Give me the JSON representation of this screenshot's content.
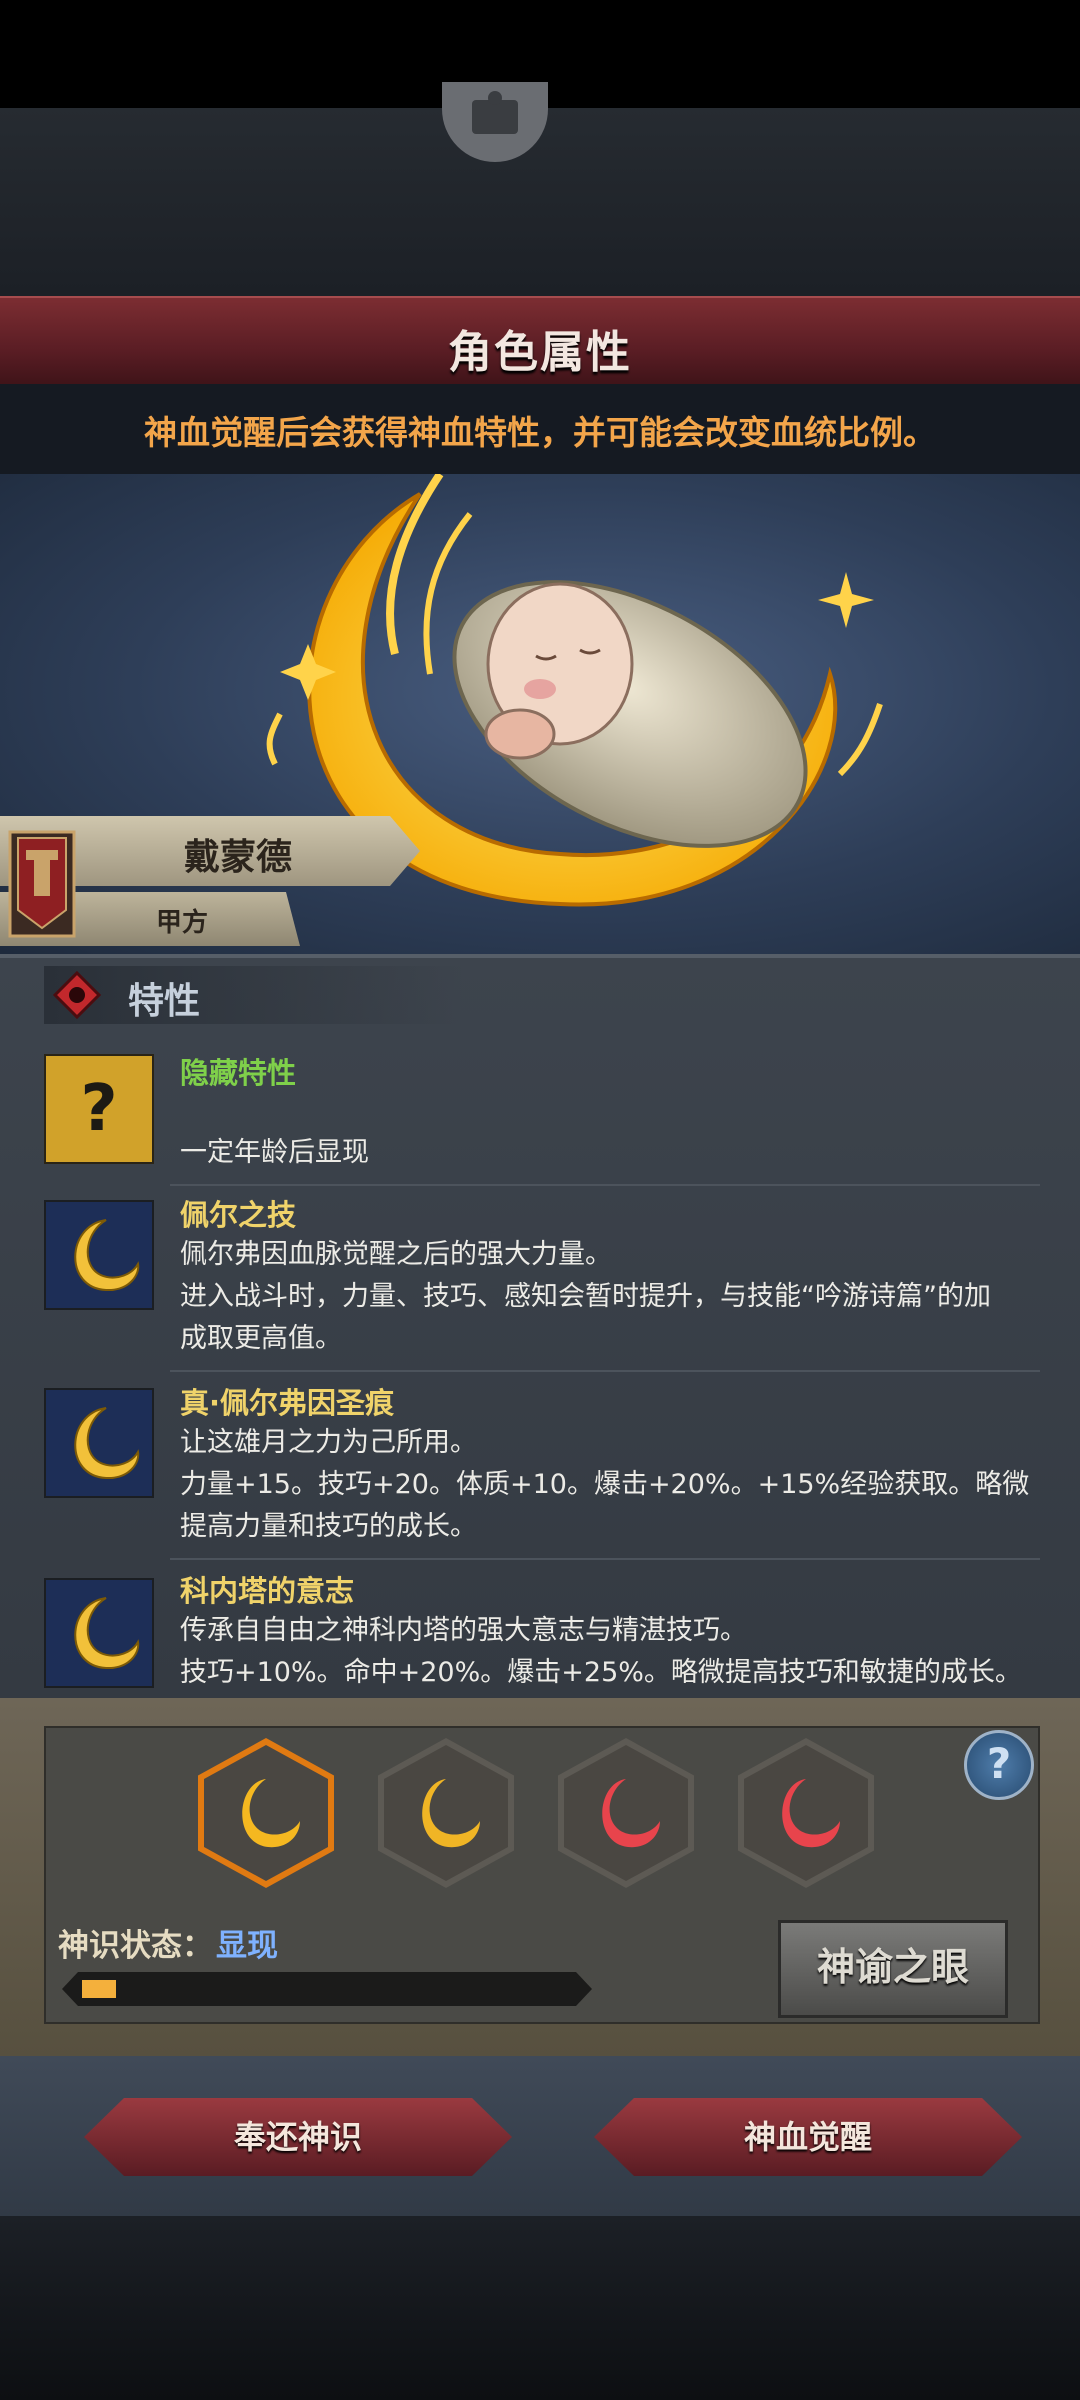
{
  "header": {
    "title": "角色属性",
    "notice": "神血觉醒后会获得神血特性，并可能会改变血统比例。"
  },
  "character": {
    "name": "戴蒙德",
    "faction": "甲方"
  },
  "traits": {
    "section_title": "特性",
    "items": [
      {
        "name": "隐藏特性",
        "lines": [
          "一定年龄后显现"
        ],
        "icon": "question-mark-icon",
        "name_color": "#7fd04a"
      },
      {
        "name": "佩尔之技",
        "lines": [
          "佩尔弗因血脉觉醒之后的强大力量。",
          "进入战斗时，力量、技巧、感知会暂时提升，与技能“吟游诗篇”的加",
          "成取更高值。"
        ],
        "icon": "crescent-moon-icon",
        "name_color": "#f0d36a"
      },
      {
        "name": "真·佩尔弗因圣痕",
        "lines": [
          "让这雄月之力为己所用。",
          "力量+15。技巧+20。体质+10。爆击+20%。+15%经验获取。略微",
          "提高力量和技巧的成长。"
        ],
        "icon": "crescent-moon-icon",
        "name_color": "#f0d36a"
      },
      {
        "name": "科内塔的意志",
        "lines": [
          "传承自自由之神科内塔的强大意志与精湛技巧。",
          "技巧+10%。命中+20%。爆击+25%。略微提高技巧和敏捷的成长。"
        ],
        "icon": "crescent-moon-icon",
        "name_color": "#f0d36a"
      }
    ]
  },
  "awakening": {
    "slots": [
      {
        "icon": "gold-crescent-icon",
        "selected": true
      },
      {
        "icon": "gold-crescent-icon",
        "selected": false
      },
      {
        "icon": "red-crescent-icon",
        "selected": false
      },
      {
        "icon": "red-crescent-icon",
        "selected": false
      }
    ],
    "status_label": "神识状态：",
    "status_value": "显现",
    "progress": 0.07,
    "help_label": "?",
    "oracle_button": "神谕之眼"
  },
  "buttons": {
    "return_label": "奉还神识",
    "awaken_label": "神血觉醒"
  },
  "colors": {
    "accent_orange": "#f3a54a",
    "status_blue": "#7fb2ff",
    "progress_fill": "#f4b03c"
  }
}
